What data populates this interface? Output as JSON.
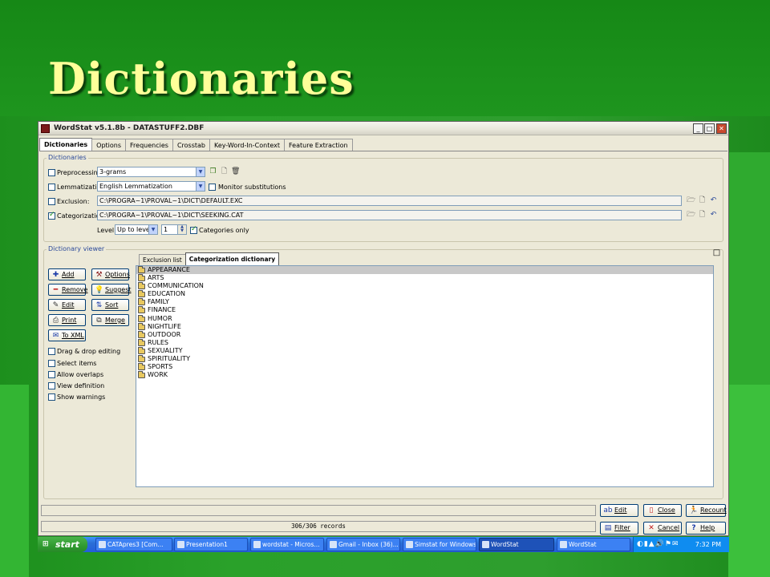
{
  "slide": {
    "title": "Dictionaries"
  },
  "window": {
    "title": "WordStat v5.1.8b - DATASTUFF2.DBF",
    "controls": {
      "minimize": "_",
      "maximize": "□",
      "close": "✕"
    }
  },
  "tabs": [
    "Dictionaries",
    "Options",
    "Frequencies",
    "Crosstab",
    "Key-Word-In-Context",
    "Feature Extraction"
  ],
  "dictionaries": {
    "group_label": "Dictionaries",
    "preprocessing": {
      "label": "Preprocessing:",
      "value": "3-grams",
      "checked": false
    },
    "lemmatization": {
      "label": "Lemmatization",
      "value": "English Lemmatization",
      "checked": false,
      "monitor_label": "Monitor substitutions"
    },
    "exclusion": {
      "label": "Exclusion:",
      "path": "C:\\PROGRA~1\\PROVAL~1\\DICT\\DEFAULT.EXC",
      "checked": false
    },
    "categorization": {
      "label": "Categorization:",
      "path": "C:\\PROGRA~1\\PROVAL~1\\DICT\\SEEKING.CAT",
      "checked": true
    },
    "level": {
      "label": "Level:",
      "mode": "Up to level",
      "value": "1"
    },
    "categories_only": {
      "label": "Categories only",
      "checked": true
    }
  },
  "viewer": {
    "group_label": "Dictionary viewer",
    "buttons": {
      "add": "Add",
      "options": "Options",
      "remove": "Remove",
      "suggest": "Suggest",
      "edit": "Edit",
      "sort": "Sort",
      "print": "Print",
      "merge": "Merge",
      "to_xml": "To XML"
    },
    "checkboxes": [
      "Drag & drop editing",
      "Select items",
      "Allow overlaps",
      "View definition",
      "Show warnings"
    ],
    "subtabs": [
      "Exclusion list",
      "Categorization dictionary"
    ],
    "items": [
      "APPEARANCE",
      "ARTS",
      "COMMUNICATION",
      "EDUCATION",
      "FAMILY",
      "FINANCE",
      "HUMOR",
      "NIGHTLIFE",
      "OUTDOOR",
      "RULES",
      "SEXUALITY",
      "SPIRITUALITY",
      "SPORTS",
      "WORK"
    ]
  },
  "status": {
    "records": "306/306 records"
  },
  "bottom_buttons": {
    "edit": "Edit",
    "close": "Close",
    "recount": "Recount",
    "filter": "Filter",
    "cancel": "Cancel",
    "help": "Help"
  },
  "taskbar": {
    "start": "start",
    "tasks": [
      "CATApres3 [Com...",
      "Presentation1",
      "wordstat - Micros...",
      "Gmail - Inbox (36)...",
      "Simstat for Windows",
      "WordStat",
      "WordStat"
    ],
    "clock": "7:32 PM"
  },
  "colors": {
    "title": "#ffff99",
    "slide_bg": "#2aa12a",
    "window_bg": "#ece9d8",
    "selection": "#c8c8c8"
  },
  "icons": [
    "folder-icon",
    "add-icon",
    "remove-icon",
    "edit-icon",
    "print-icon",
    "xml-icon",
    "options-icon",
    "suggest-icon",
    "sort-icon",
    "merge-icon",
    "open-icon",
    "new-icon",
    "undo-icon",
    "delete-icon"
  ]
}
